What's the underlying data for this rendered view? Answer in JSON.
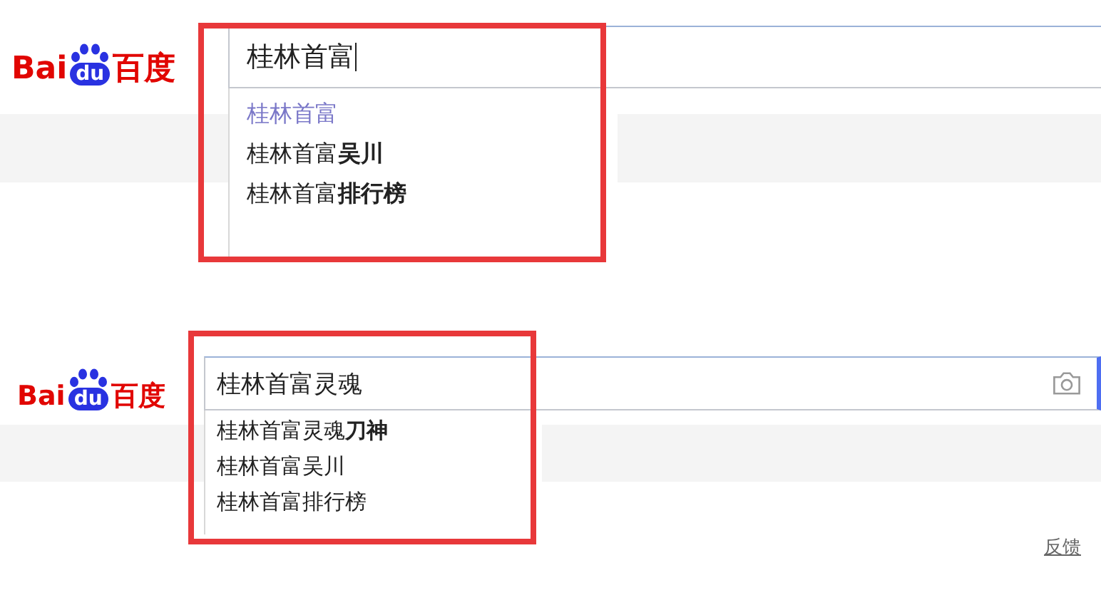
{
  "panels": [
    {
      "logo": {
        "latin": "Bai",
        "badge": "du",
        "chinese": "百度"
      },
      "search": {
        "value": "桂林首富",
        "caret": true
      },
      "suggestions": [
        {
          "text": "桂林首富",
          "visited": true
        },
        {
          "text": "桂林首富**吴川**",
          "visited": false
        },
        {
          "text": "桂林首富**排行榜**",
          "visited": false
        }
      ]
    },
    {
      "logo": {
        "latin": "Bai",
        "badge": "du",
        "chinese": "百度"
      },
      "search": {
        "value": "桂林首富灵魂",
        "camera": true
      },
      "suggestions": [
        {
          "text": "桂林首富灵魂**刀神**",
          "visited": false
        },
        {
          "text": "桂林首富吴川",
          "visited": false
        },
        {
          "text": "桂林首富排行榜",
          "visited": false
        }
      ],
      "feedback": "反馈"
    }
  ]
}
